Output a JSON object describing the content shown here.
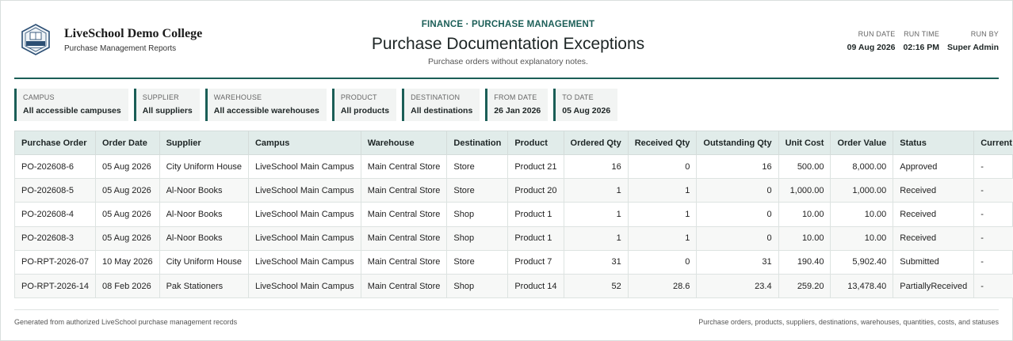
{
  "brand": {
    "name": "LiveSchool Demo College",
    "subtitle": "Purchase Management Reports",
    "colors": {
      "accent": "#1b5e57",
      "header_bg": "#e1ecea"
    }
  },
  "header": {
    "kicker": "FINANCE · PURCHASE MANAGEMENT",
    "title": "Purchase Documentation Exceptions",
    "subtitle": "Purchase orders without explanatory notes."
  },
  "run": [
    {
      "label": "RUN DATE",
      "value": "09 Aug 2026"
    },
    {
      "label": "RUN TIME",
      "value": "02:16 PM"
    },
    {
      "label": "RUN BY",
      "value": "Super Admin"
    }
  ],
  "filters": [
    {
      "label": "CAMPUS",
      "value": "All accessible campuses"
    },
    {
      "label": "SUPPLIER",
      "value": "All suppliers"
    },
    {
      "label": "WAREHOUSE",
      "value": "All accessible warehouses"
    },
    {
      "label": "PRODUCT",
      "value": "All products"
    },
    {
      "label": "DESTINATION",
      "value": "All destinations"
    },
    {
      "label": "FROM DATE",
      "value": "26 Jan 2026"
    },
    {
      "label": "TO DATE",
      "value": "05 Aug 2026"
    }
  ],
  "table": {
    "columns": [
      "Purchase Order",
      "Order Date",
      "Supplier",
      "Campus",
      "Warehouse",
      "Destination",
      "Product",
      "Ordered Qty",
      "Received Qty",
      "Outstanding Qty",
      "Unit Cost",
      "Order Value",
      "Status",
      "Current Stage"
    ],
    "rows": [
      [
        "PO-202608-6",
        "05 Aug 2026",
        "City Uniform House",
        "LiveSchool Main Campus",
        "Main Central Store",
        "Store",
        "Product 21",
        "16",
        "0",
        "16",
        "500.00",
        "8,000.00",
        "Approved",
        "-"
      ],
      [
        "PO-202608-5",
        "05 Aug 2026",
        "Al-Noor Books",
        "LiveSchool Main Campus",
        "Main Central Store",
        "Store",
        "Product 20",
        "1",
        "1",
        "0",
        "1,000.00",
        "1,000.00",
        "Received",
        "-"
      ],
      [
        "PO-202608-4",
        "05 Aug 2026",
        "Al-Noor Books",
        "LiveSchool Main Campus",
        "Main Central Store",
        "Shop",
        "Product 1",
        "1",
        "1",
        "0",
        "10.00",
        "10.00",
        "Received",
        "-"
      ],
      [
        "PO-202608-3",
        "05 Aug 2026",
        "Al-Noor Books",
        "LiveSchool Main Campus",
        "Main Central Store",
        "Shop",
        "Product 1",
        "1",
        "1",
        "0",
        "10.00",
        "10.00",
        "Received",
        "-"
      ],
      [
        "PO-RPT-2026-07",
        "10 May 2026",
        "City Uniform House",
        "LiveSchool Main Campus",
        "Main Central Store",
        "Store",
        "Product 7",
        "31",
        "0",
        "31",
        "190.40",
        "5,902.40",
        "Submitted",
        "-"
      ],
      [
        "PO-RPT-2026-14",
        "08 Feb 2026",
        "Pak Stationers",
        "LiveSchool Main Campus",
        "Main Central Store",
        "Shop",
        "Product 14",
        "52",
        "28.6",
        "23.4",
        "259.20",
        "13,478.40",
        "PartiallyReceived",
        "-"
      ]
    ]
  },
  "footer": {
    "left": "Generated from authorized LiveSchool purchase management records",
    "right": "Purchase orders, products, suppliers, destinations, warehouses, quantities, costs, and statuses"
  }
}
